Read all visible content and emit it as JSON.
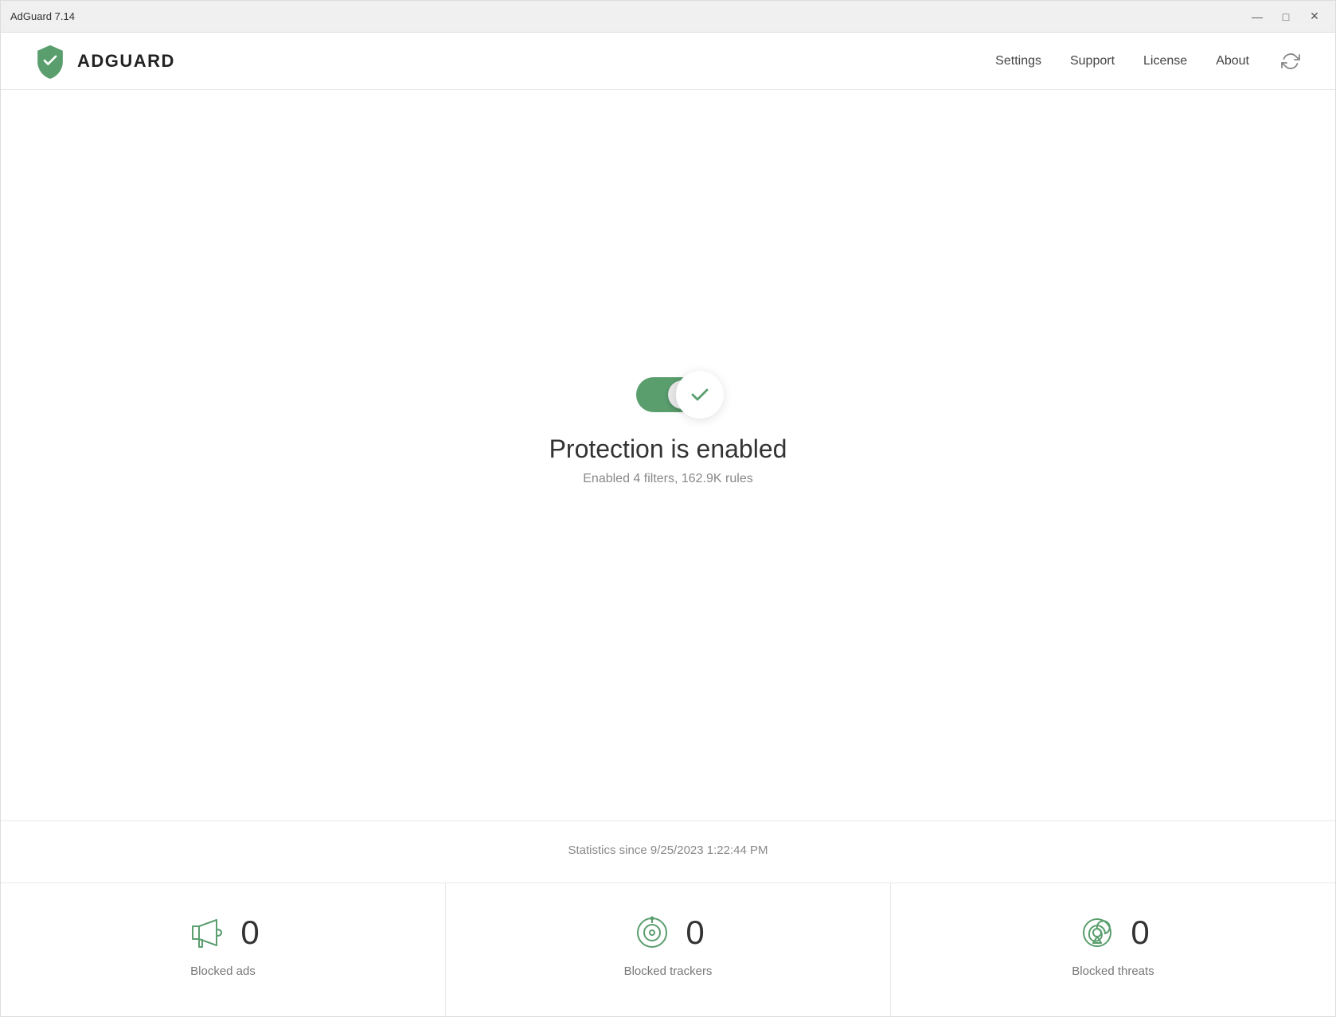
{
  "window": {
    "title": "AdGuard 7.14",
    "controls": {
      "minimize": "—",
      "maximize": "□",
      "close": "✕"
    }
  },
  "header": {
    "logo_text": "ADGUARD",
    "nav": {
      "settings": "Settings",
      "support": "Support",
      "license": "License",
      "about": "About"
    }
  },
  "protection": {
    "status_title": "Protection is enabled",
    "status_subtitle": "Enabled 4 filters, 162.9K rules"
  },
  "statistics": {
    "since_label": "Statistics since 9/25/2023 1:22:44 PM",
    "items": [
      {
        "label": "Blocked ads",
        "count": "0"
      },
      {
        "label": "Blocked trackers",
        "count": "0"
      },
      {
        "label": "Blocked threats",
        "count": "0"
      }
    ]
  },
  "colors": {
    "green": "#5a9e6e",
    "green_light": "#6aaf7e"
  }
}
